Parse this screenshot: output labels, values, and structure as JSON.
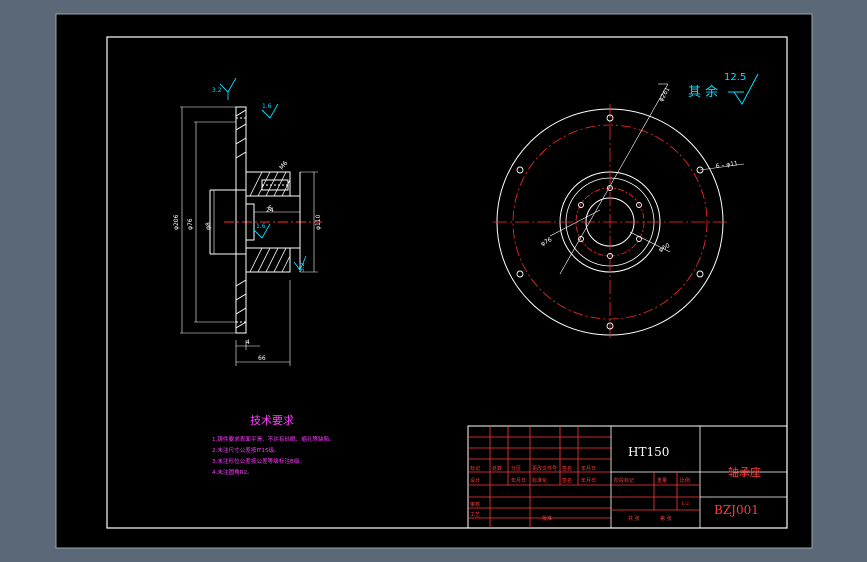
{
  "colors": {
    "background": "#5b6877",
    "paper": "#000000",
    "line": "#ffffff",
    "centerline": "#ff2a2a",
    "table": "#ff3b3b",
    "dimension": "#00e5e5",
    "note_text": "#ff3cff",
    "surface_mark": "#00e0ff"
  },
  "roughness": {
    "other_label": "其 余",
    "other_value": "12.5",
    "marks": [
      "3.2",
      "1.6",
      "1.6",
      "3.2"
    ]
  },
  "front_view": {
    "dims": [
      "φ206",
      "φ76",
      "φ110",
      "φ8",
      "M6",
      "6",
      "4",
      "66",
      "24"
    ]
  },
  "top_view": {
    "dims": [
      "φ261",
      "φ60",
      "φ76",
      "6 – φ11"
    ]
  },
  "tech_requirements": {
    "title": "技术要求",
    "items": [
      "1.铸件要求表面平滑、不许有砂眼、缩孔等缺陷。",
      "2.未注尺寸公差按IT15级。",
      "3.未注形位公差按公差等级标注B级。",
      "4.未注圆角R2。"
    ]
  },
  "title_block": {
    "material": "HT150",
    "part_name": "轴承座",
    "drawing_no": "BZJ001",
    "scale": "1:2",
    "row_marks": [
      "标记",
      "处数",
      "分区",
      "更改文件号",
      "签名",
      "年月日"
    ],
    "row_design": [
      "设计",
      "",
      "年月日",
      "标准化",
      "签名",
      "年月日"
    ],
    "row_review": "审核",
    "row_process": "工艺",
    "approve": "批准",
    "stage_mark": "阶段标记",
    "weight": "重量",
    "ratio": "比例",
    "sheets_total": "共 张",
    "sheet_no": "第 张"
  }
}
